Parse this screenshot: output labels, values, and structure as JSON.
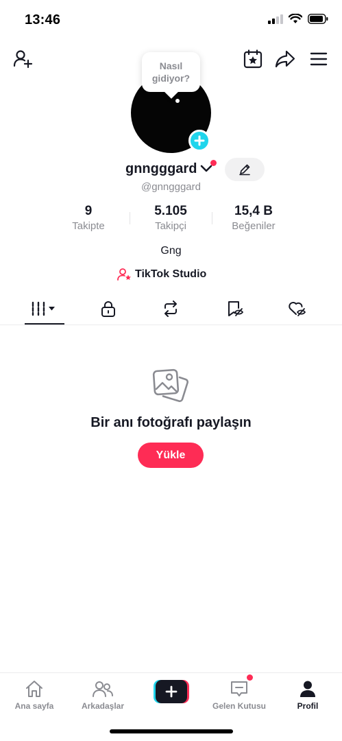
{
  "status_bar": {
    "time": "13:46"
  },
  "profile": {
    "bubble_line1": "Nasıl",
    "bubble_line2": "gidiyor?",
    "username": "gnngggard",
    "handle": "@gnngggard",
    "bio": "Gng",
    "studio_label": "TikTok Studio"
  },
  "stats": [
    {
      "value": "9",
      "label": "Takipte"
    },
    {
      "value": "5.105",
      "label": "Takipçi"
    },
    {
      "value": "15,4 B",
      "label": "Beğeniler"
    }
  ],
  "empty_state": {
    "title": "Bir anı fotoğrafı paylaşın",
    "button": "Yükle"
  },
  "bottom_nav": [
    {
      "label": "Ana sayfa",
      "icon": "home-icon"
    },
    {
      "label": "Arkadaşlar",
      "icon": "friends-icon"
    },
    {
      "label": "",
      "icon": "create-icon"
    },
    {
      "label": "Gelen Kutusu",
      "icon": "inbox-icon"
    },
    {
      "label": "Profil",
      "icon": "profile-icon"
    }
  ],
  "colors": {
    "accent": "#fe2c55",
    "cyan": "#20d5ec",
    "text": "#161823",
    "muted": "#8a8b91"
  }
}
